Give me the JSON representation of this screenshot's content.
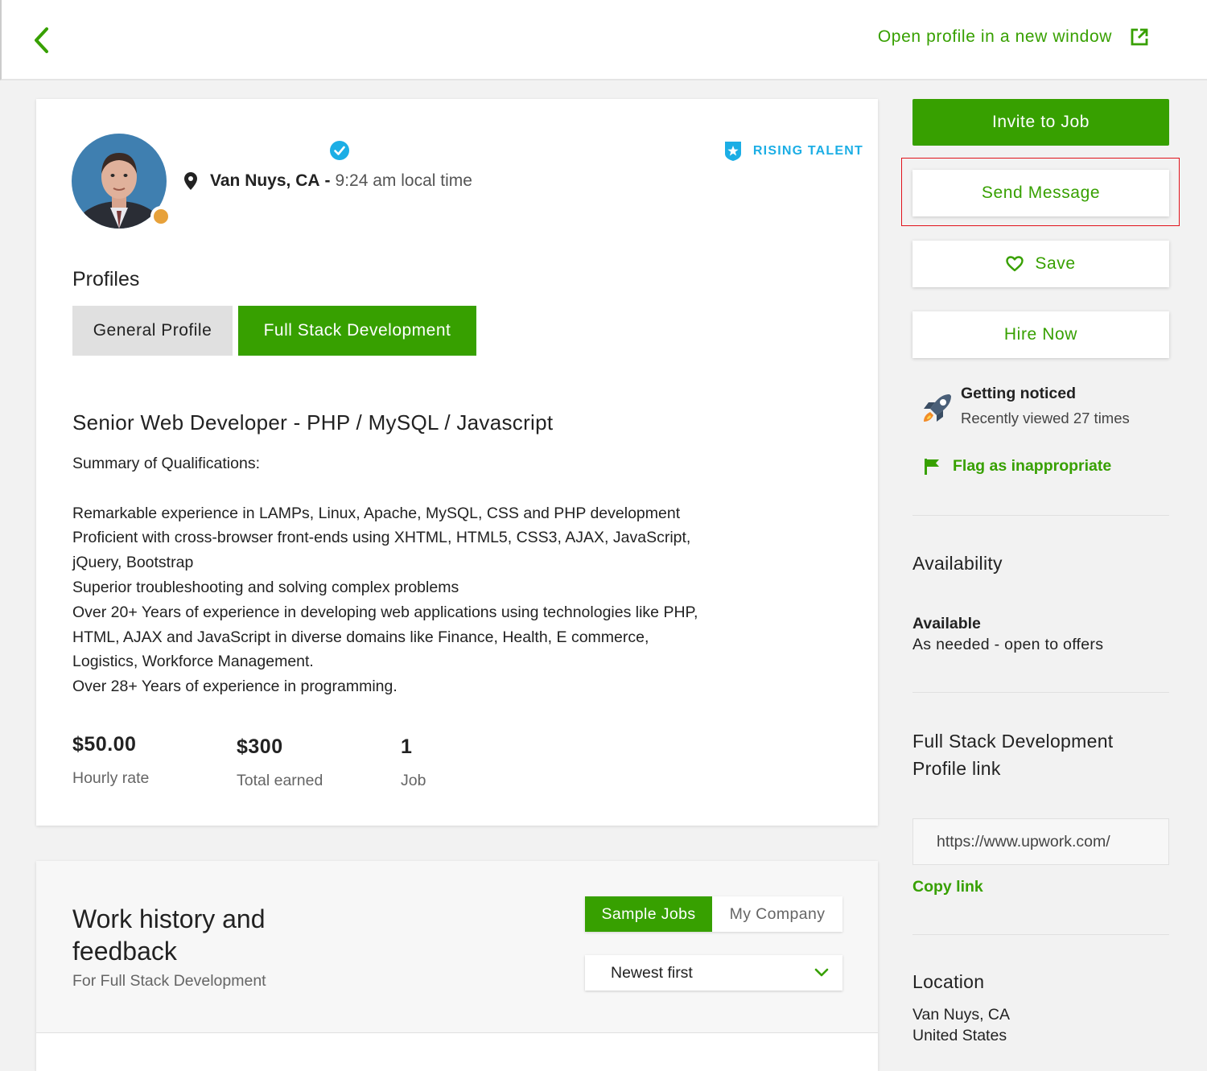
{
  "header": {
    "open_profile_label": "Open profile in a new window"
  },
  "profile": {
    "rising_talent_label": "RISING TALENT",
    "city": "Van Nuys, CA",
    "separator": "-",
    "local_time": "9:24 am local time",
    "profiles_heading": "Profiles",
    "tabs": [
      {
        "label": "General Profile",
        "active": false
      },
      {
        "label": "Full Stack Development",
        "active": true
      }
    ],
    "title": "Senior Web Developer - PHP / MySQL / Javascript",
    "summary_heading": "Summary of Qualifications:",
    "summary_lines": [
      "Remarkable experience in LAMPs, Linux, Apache, MySQL, CSS and PHP development",
      "Proficient with cross-browser front-ends using XHTML, HTML5, CSS3, AJAX, JavaScript,",
      "jQuery, Bootstrap",
      "Superior troubleshooting and solving complex problems",
      "Over 20+ Years of experience in developing web applications using technologies like PHP,",
      "HTML, AJAX and JavaScript in diverse domains like Finance, Health, E commerce,",
      "Logistics, Workforce Management.",
      "Over 28+ Years of experience in programming."
    ],
    "stats": [
      {
        "value": "$50.00",
        "label": "Hourly rate"
      },
      {
        "value": "$300",
        "label": "Total earned"
      },
      {
        "value": "1",
        "label": "Job"
      }
    ]
  },
  "work_history": {
    "title": "Work history and feedback",
    "subtitle": "For Full Stack Development",
    "toggle": [
      {
        "label": "Sample Jobs",
        "active": true
      },
      {
        "label": "My Company",
        "active": false
      }
    ],
    "sort_value": "Newest first"
  },
  "sidebar": {
    "invite_label": "Invite to Job",
    "send_message_label": "Send Message",
    "save_label": "Save",
    "hire_now_label": "Hire Now",
    "getting_noticed_title": "Getting noticed",
    "getting_noticed_text": "Recently viewed 27 times",
    "flag_label": "Flag as inappropriate",
    "availability_heading": "Availability",
    "availability_status": "Available",
    "availability_detail": "As needed - open to offers",
    "profile_link_heading": "Full Stack Development Profile link",
    "profile_link_value": "https://www.upwork.com/",
    "copy_link_label": "Copy link",
    "location_heading": "Location",
    "location_city": "Van Nuys, CA",
    "location_country": "United States"
  },
  "colors": {
    "brand_green": "#37a000",
    "rising_talent_blue": "#1caee5",
    "status_orange": "#e7a13a",
    "highlight_red": "#e1131b"
  },
  "icons": [
    "chevron-left-icon",
    "external-link-icon",
    "verified-badge-icon",
    "shield-star-icon",
    "map-pin-icon",
    "heart-icon",
    "rocket-icon",
    "flag-icon",
    "chevron-down-icon"
  ]
}
